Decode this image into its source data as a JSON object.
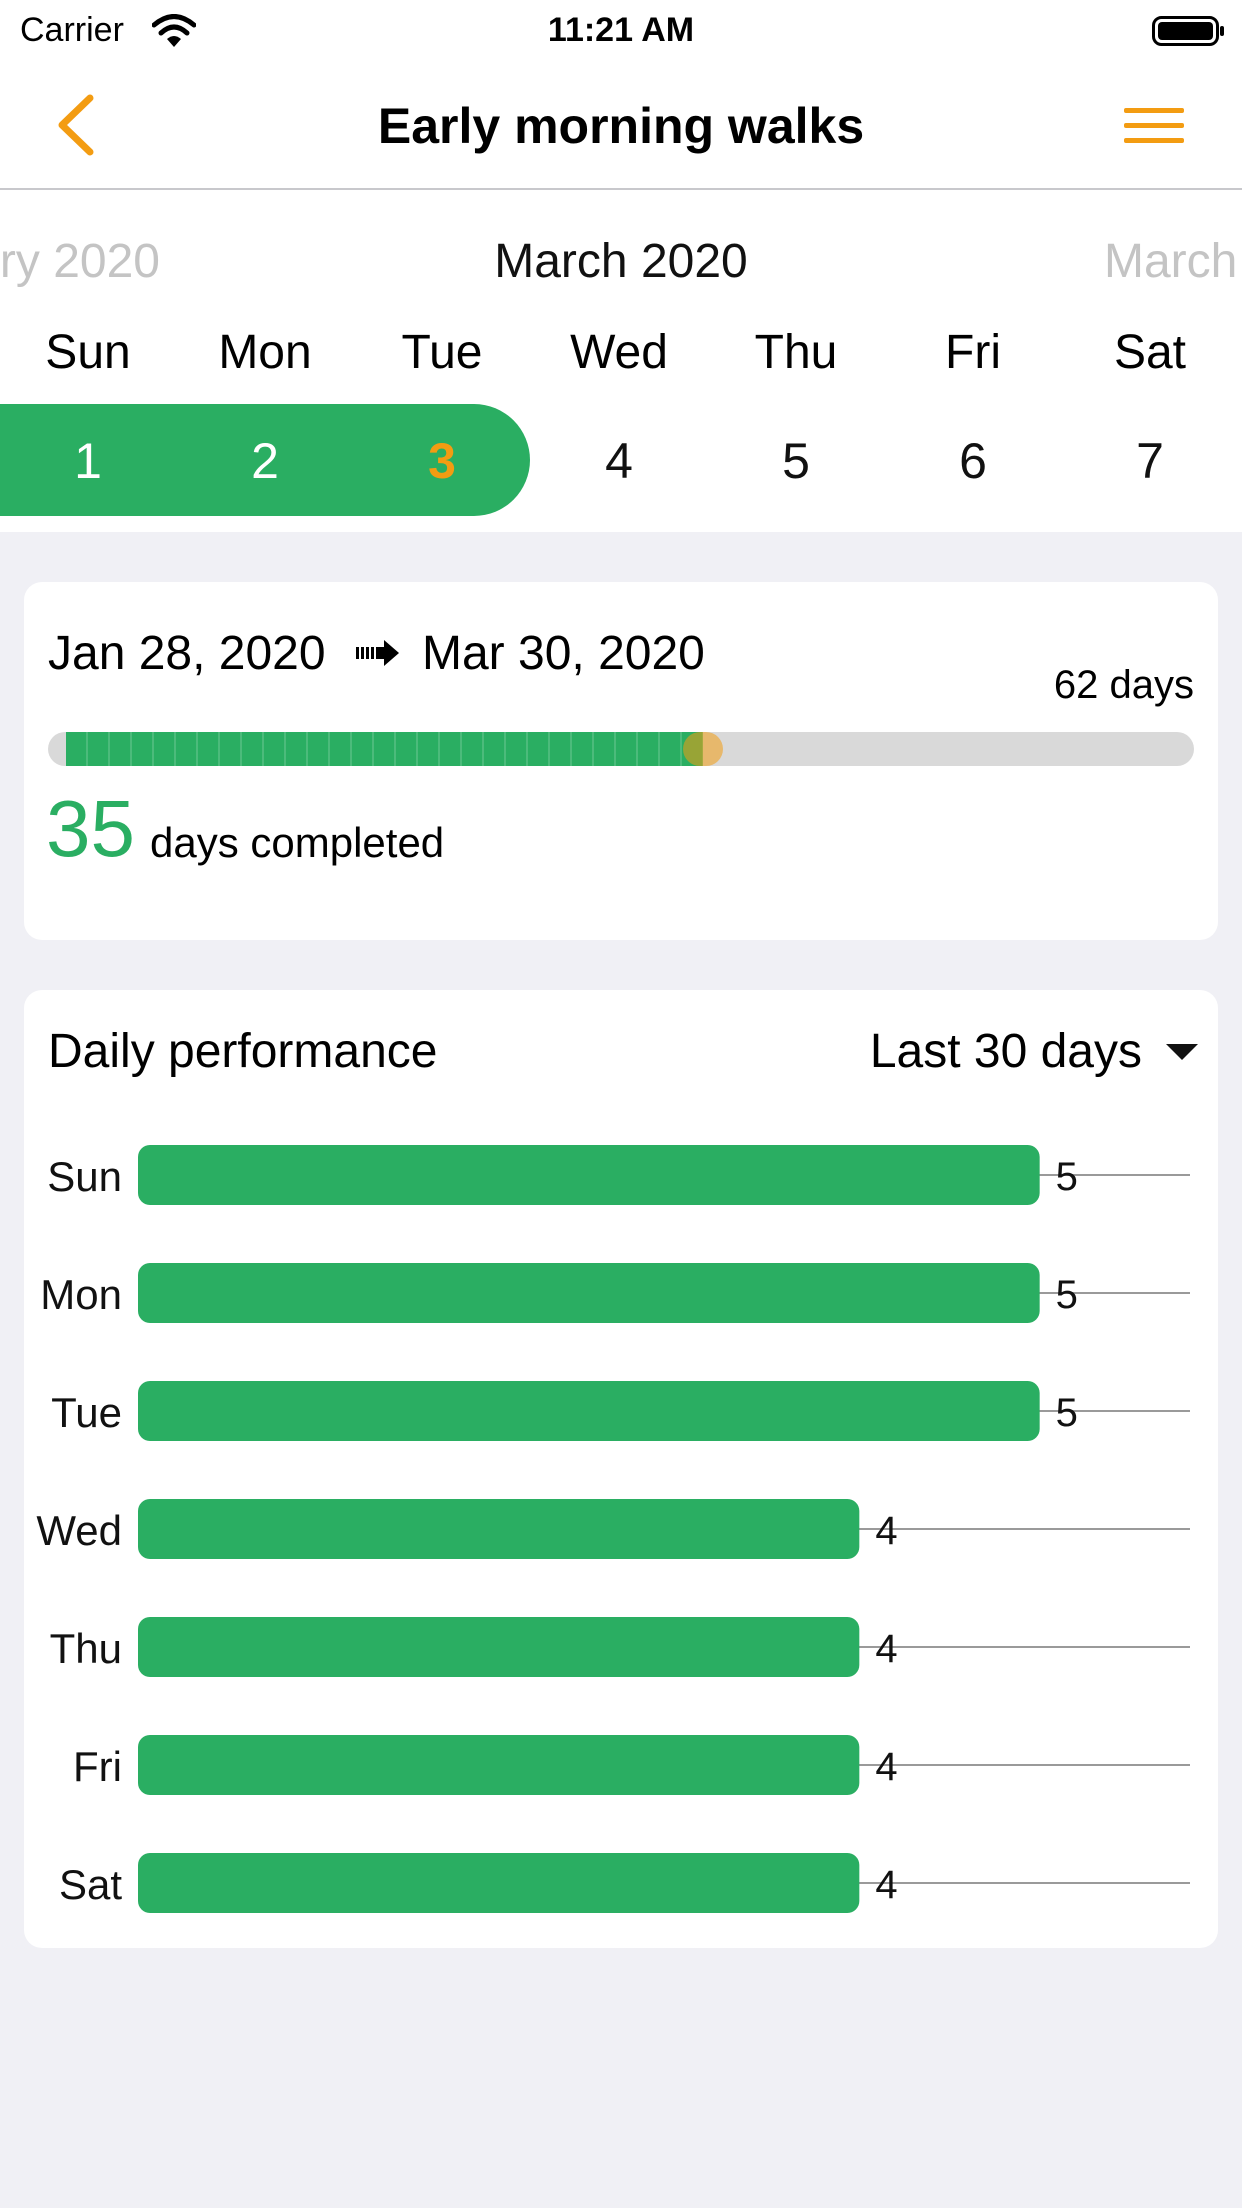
{
  "status_bar": {
    "carrier": "Carrier",
    "time": "11:21 AM",
    "wifi_icon": "wifi-icon",
    "battery_icon": "battery-full-icon"
  },
  "nav": {
    "title": "Early morning walks",
    "back_icon": "chevron-left-icon",
    "menu_icon": "hamburger-menu-icon",
    "accent_color": "#f39c12"
  },
  "calendar": {
    "prev_month": "ry 2020",
    "current_month": "March 2020",
    "next_month": "March",
    "weekdays": [
      "Sun",
      "Mon",
      "Tue",
      "Wed",
      "Thu",
      "Fri",
      "Sat"
    ],
    "dates": [
      "1",
      "2",
      "3",
      "4",
      "5",
      "6",
      "7"
    ],
    "streak_dates": [
      "1",
      "2",
      "3"
    ],
    "today": "3",
    "streak_color": "#2aae62",
    "today_color": "#f39c12"
  },
  "summary": {
    "start_date": "Jan 28, 2020",
    "end_date": "Mar 30, 2020",
    "arrow_icon": "arrow-right-icon",
    "total_days": "62 days",
    "completed_count": "35",
    "completed_label": "days completed",
    "progress_fraction": 0.565
  },
  "performance": {
    "title": "Daily performance",
    "range_label": "Last 30 days",
    "range_icon": "caret-down-icon"
  },
  "chart_data": {
    "type": "bar",
    "orientation": "horizontal",
    "categories": [
      "Sun",
      "Mon",
      "Tue",
      "Wed",
      "Thu",
      "Fri",
      "Sat"
    ],
    "values": [
      5,
      5,
      5,
      4,
      4,
      4,
      4
    ],
    "xlim": [
      0,
      6
    ],
    "bar_color": "#2aae62",
    "grid": true,
    "data_labels": true,
    "title": "",
    "xlabel": "",
    "ylabel": ""
  }
}
